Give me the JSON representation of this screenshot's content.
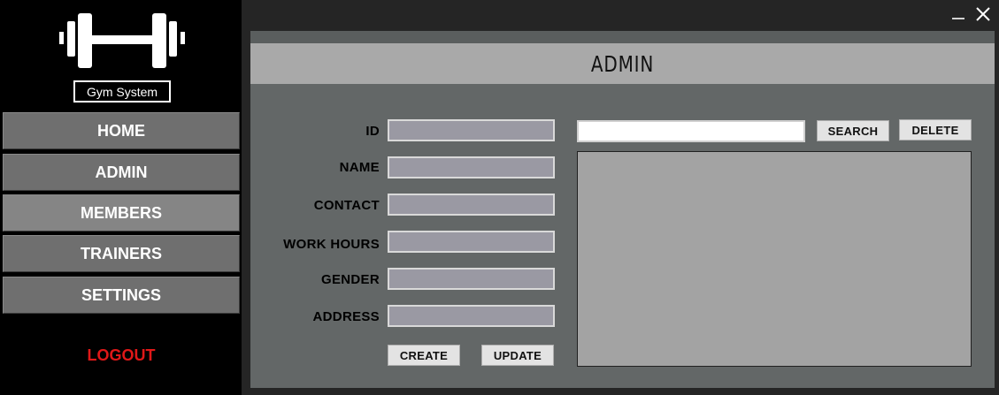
{
  "sidebar": {
    "brand": "Gym System",
    "logo_icon": "dumbbell-icon",
    "items": [
      {
        "label": "HOME"
      },
      {
        "label": "ADMIN"
      },
      {
        "label": "MEMBERS"
      },
      {
        "label": "TRAINERS"
      },
      {
        "label": "SETTINGS"
      }
    ],
    "logout_label": "LOGOUT"
  },
  "window": {
    "minimize_icon": "minimize-icon",
    "close_icon": "close-icon"
  },
  "main": {
    "title": "ADMIN",
    "fields": [
      {
        "label": "ID",
        "value": ""
      },
      {
        "label": "NAME",
        "value": ""
      },
      {
        "label": "CONTACT",
        "value": ""
      },
      {
        "label": "WORK HOURS",
        "value": ""
      },
      {
        "label": "GENDER",
        "value": ""
      },
      {
        "label": "ADDRESS",
        "value": ""
      }
    ],
    "create_label": "CREATE",
    "update_label": "UPDATE",
    "search_value": "",
    "search_label": "SEARCH",
    "delete_label": "DELETE"
  },
  "colors": {
    "sidebar_bg": "#000000",
    "nav_button": "#6f6f6f",
    "nav_button_active": "#858585",
    "logout": "#e01818",
    "panel_bg": "#636767",
    "header_bar": "#a9a9a9",
    "input_bg": "#9a99a3",
    "table_bg": "#a3a3a3"
  }
}
